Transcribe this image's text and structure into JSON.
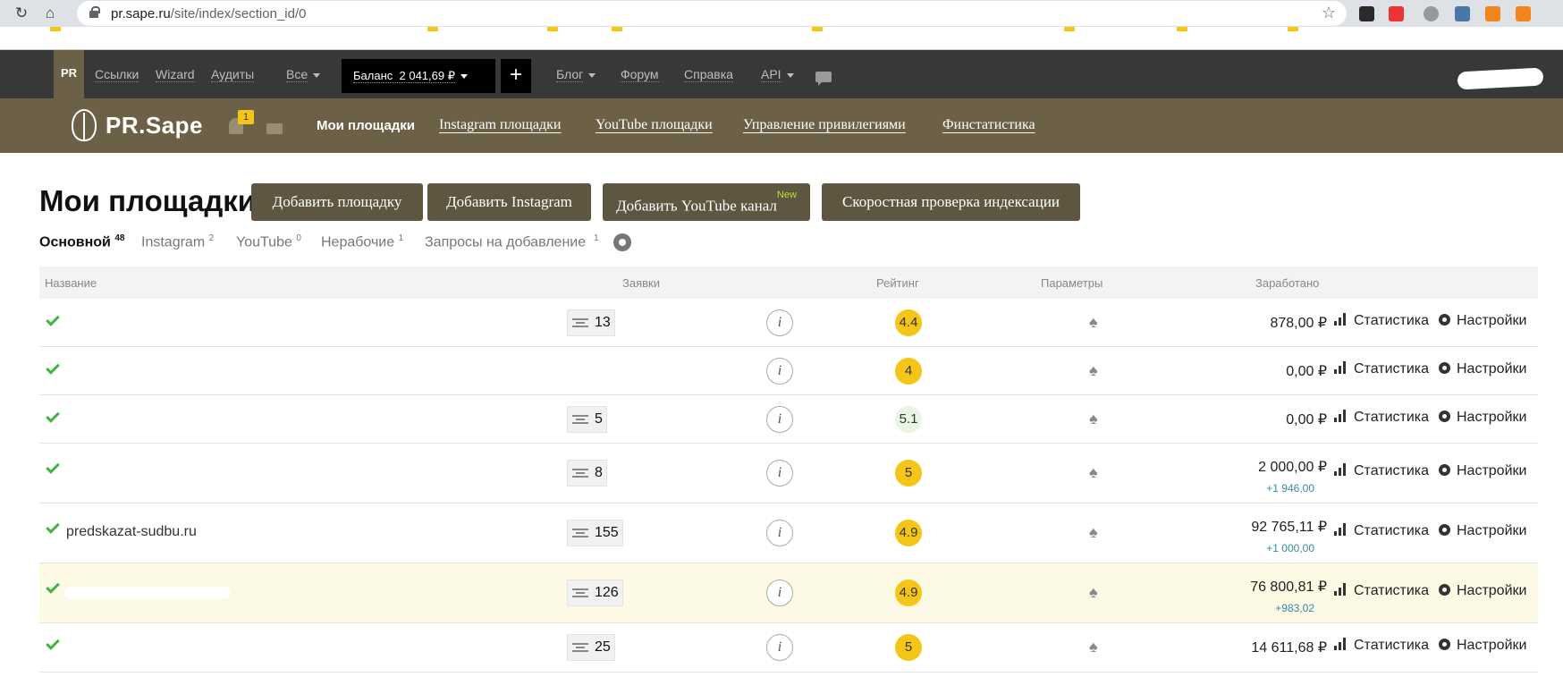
{
  "browser": {
    "url_host": "pr.sape.ru",
    "url_path": "/site/index/section_id/0"
  },
  "topbar": {
    "pr_label": "PR",
    "links": [
      "Ссылки",
      "Wizard",
      "Аудиты",
      "Все"
    ],
    "balance_label": "Баланс",
    "balance_value": "2 041,69 ₽",
    "plus": "+",
    "right_links": [
      "Блог",
      "Форум",
      "Справка",
      "API"
    ]
  },
  "brand": {
    "logo_text": "PR.Sape",
    "notifications_count": "1"
  },
  "nav": {
    "active": "Мои площадки",
    "links": [
      "Instagram площадки",
      "YouTube площадки",
      "Управление привилегиями",
      "Финстатистика"
    ]
  },
  "main": {
    "title": "Мои площадки",
    "buttons": {
      "add_site": "Добавить площадку",
      "add_instagram": "Добавить Instagram",
      "add_youtube": "Добавить YouTube канал",
      "new_badge": "New",
      "check_index": "Скоростная проверка индексации"
    },
    "tabs": [
      {
        "label": "Основной",
        "count": "48"
      },
      {
        "label": "Instagram",
        "count": "2"
      },
      {
        "label": "YouTube",
        "count": "0"
      },
      {
        "label": "Нерабочие",
        "count": "1"
      },
      {
        "label": "Запросы на добавление",
        "count": "1"
      }
    ]
  },
  "table": {
    "headers": {
      "name": "Название",
      "requests": "Заявки",
      "rating": "Рейтинг",
      "params": "Параметры",
      "earned": "Заработано"
    },
    "info_glyph": "i",
    "spade_glyph": "♠",
    "stat_label": "Статистика",
    "settings_label": "Настройки",
    "rows": [
      {
        "site": "",
        "requests": "13",
        "rating": "4.4",
        "earned": "878,00 ₽",
        "delta": ""
      },
      {
        "site": "",
        "requests": "",
        "rating": "4",
        "earned": "0,00 ₽",
        "delta": ""
      },
      {
        "site": "",
        "requests": "5",
        "rating": "5.1",
        "earned": "0,00 ₽",
        "delta": ""
      },
      {
        "site": "",
        "requests": "8",
        "rating": "5",
        "earned": "2 000,00 ₽",
        "delta": "+1 946,00"
      },
      {
        "site": "predskazat-sudbu.ru",
        "requests": "155",
        "rating": "4.9",
        "earned": "92 765,11 ₽",
        "delta": "+1 000,00"
      },
      {
        "site": "",
        "requests": "126",
        "rating": "4.9",
        "earned": "76 800,81 ₽",
        "delta": "+983,02"
      },
      {
        "site": "",
        "requests": "25",
        "rating": "5",
        "earned": "14 611,68 ₽",
        "delta": ""
      }
    ]
  },
  "colors": {
    "brown": "#6c6146",
    "button": "#5e5641",
    "rating_yellow": "#f5c518",
    "check_green": "#43b443"
  }
}
